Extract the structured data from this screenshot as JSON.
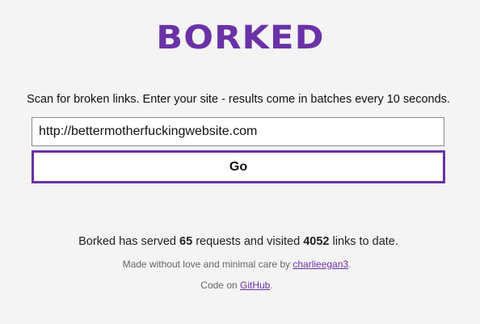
{
  "logo": {
    "text": "BORKED",
    "color": "#6a32a6"
  },
  "intro": {
    "text": "Scan for broken links. Enter your site - results come in batches every 10 seconds."
  },
  "form": {
    "url_value": "http://bettermotherfuckingwebsite.com",
    "go_label": "Go"
  },
  "stats": {
    "prefix": "Borked has served ",
    "requests": "65",
    "middle": " requests and visited ",
    "links": "4052",
    "suffix": " links to date."
  },
  "credit": {
    "prefix": "Made without love and minimal care by ",
    "author": "charlieegan3",
    "suffix": "."
  },
  "code": {
    "prefix": "Code on ",
    "link": "GitHub",
    "suffix": "."
  }
}
